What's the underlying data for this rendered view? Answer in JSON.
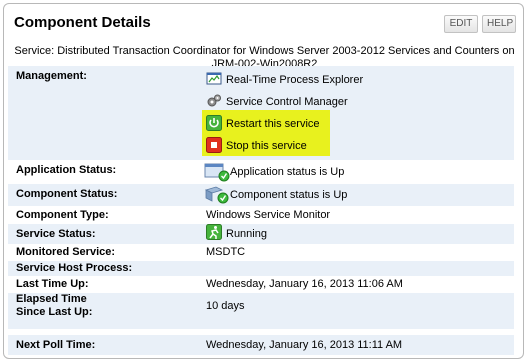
{
  "header": {
    "title": "Component Details",
    "edit_label": "EDIT",
    "help_label": "HELP"
  },
  "service": {
    "line1": "Service: Distributed Transaction Coordinator for Windows Server 2003-2012 Services and Counters on",
    "line2": "JRM-002-Win2008R2"
  },
  "management": {
    "label": "Management:",
    "items": [
      {
        "label": "Real-Time Process Explorer",
        "icon": "process-explorer-icon"
      },
      {
        "label": "Service Control Manager",
        "icon": "gears-icon"
      },
      {
        "label": "Restart this service",
        "icon": "restart-icon"
      },
      {
        "label": "Stop this service",
        "icon": "stop-icon"
      }
    ]
  },
  "details": {
    "application_status": {
      "label": "Application Status:",
      "value": "Application status is Up"
    },
    "component_status": {
      "label": "Component Status:",
      "value": "Component status is Up"
    },
    "component_type": {
      "label": "Component Type:",
      "value": "Windows Service Monitor"
    },
    "service_status": {
      "label": "Service Status:",
      "value": "Running"
    },
    "monitored_service": {
      "label": "Monitored Service:",
      "value": "MSDTC"
    },
    "service_host_process": {
      "label": "Service Host Process:",
      "value": ""
    },
    "last_time_up": {
      "label": "Last Time Up:",
      "value": "Wednesday, January 16, 2013 11:06 AM"
    },
    "elapsed_time": {
      "label_line1": "Elapsed Time",
      "label_line2": "Since Last Up:",
      "value": "10 days"
    },
    "next_poll_time": {
      "label": "Next Poll Time:",
      "value": "Wednesday, January 16, 2013 11:11 AM"
    }
  },
  "colors": {
    "row_shade": "#e9f0f8",
    "highlight": "#e8f11e",
    "status_up": "#3cb93c"
  }
}
